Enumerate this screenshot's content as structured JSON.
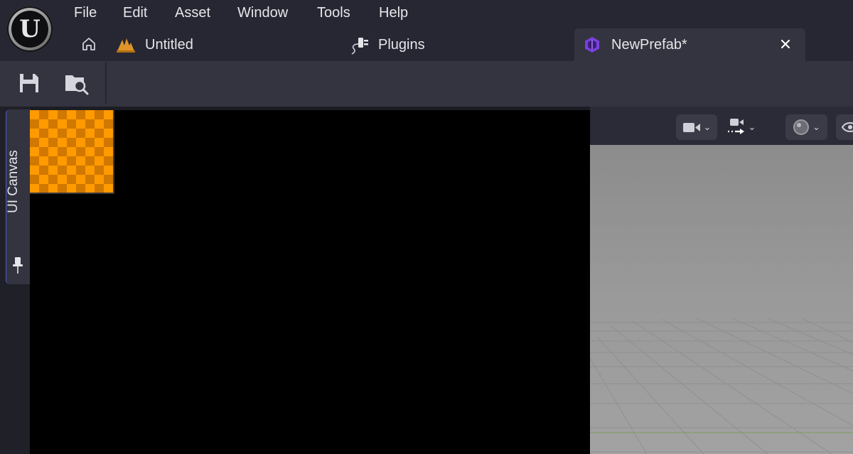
{
  "menu": {
    "items": [
      "File",
      "Edit",
      "Asset",
      "Window",
      "Tools",
      "Help"
    ]
  },
  "tabs": [
    {
      "label": "Untitled",
      "icon": "level-icon"
    },
    {
      "label": "Plugins",
      "icon": "plugin-icon"
    },
    {
      "label": "NewPrefab*",
      "icon": "prefab-icon",
      "active": true
    }
  ],
  "toolbar": {
    "save_icon": "save-icon",
    "browse_icon": "browse-content-icon"
  },
  "side_panel": {
    "tab_label": "UI Canvas",
    "pin_icon": "pin-icon"
  },
  "viewport_toolbar": {
    "buttons": [
      "camera-icon",
      "camera-move-icon",
      "lighting-icon",
      "show-icon"
    ]
  },
  "colors": {
    "accent": "#4a5bd4",
    "prefab": "#7b3fe0",
    "checker_light": "#ff9a00",
    "checker_dark": "#d07800"
  }
}
